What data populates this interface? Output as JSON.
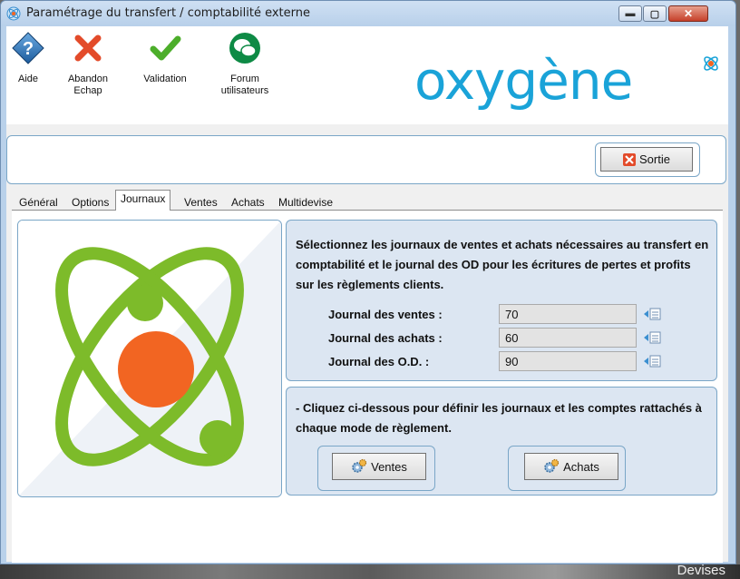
{
  "window": {
    "title": "Paramétrage du transfert / comptabilité externe",
    "minimize_glyph": "▬",
    "maximize_glyph": "▢",
    "close_glyph": "✕"
  },
  "toolbar": {
    "items": [
      {
        "label": "Aide",
        "icon": "help-icon"
      },
      {
        "label": "Abandon\nEchap",
        "icon": "cancel-icon"
      },
      {
        "label": "Validation",
        "icon": "checkmark-icon"
      },
      {
        "label": "Forum\nutilisateurs",
        "icon": "forum-icon"
      }
    ],
    "brand": "oxygène"
  },
  "top_panel": {
    "exit_label": "Sortie"
  },
  "tabs": [
    {
      "label": "Général"
    },
    {
      "label": "Options"
    },
    {
      "label": "Journaux"
    },
    {
      "label": "Ventes"
    },
    {
      "label": "Achats"
    },
    {
      "label": "Multidevise"
    }
  ],
  "active_tab": "Journaux",
  "journaux": {
    "description": "Sélectionnez les journaux de ventes et achats nécessaires au transfert en comptabilité et le journal des OD pour les écritures de pertes et profits sur les règlements clients.",
    "fields": [
      {
        "label": "Journal des ventes :",
        "value": "70"
      },
      {
        "label": "Journal des achats :",
        "value": "60"
      },
      {
        "label": "Journal des O.D. :",
        "value": "90"
      }
    ]
  },
  "modes": {
    "description": "- Cliquez ci-dessous pour définir les journaux et les comptes rattachés à chaque mode de règlement.",
    "sales_button": "Ventes",
    "purchases_button": "Achats"
  },
  "taskbar": {
    "fragment": "Devises"
  },
  "colors": {
    "brand": "#1aa3d8",
    "atom_green": "#7dbb2a",
    "atom_core": "#f26522",
    "panel_blue": "#dce6f2",
    "frame_blue": "#7aa6c7"
  }
}
